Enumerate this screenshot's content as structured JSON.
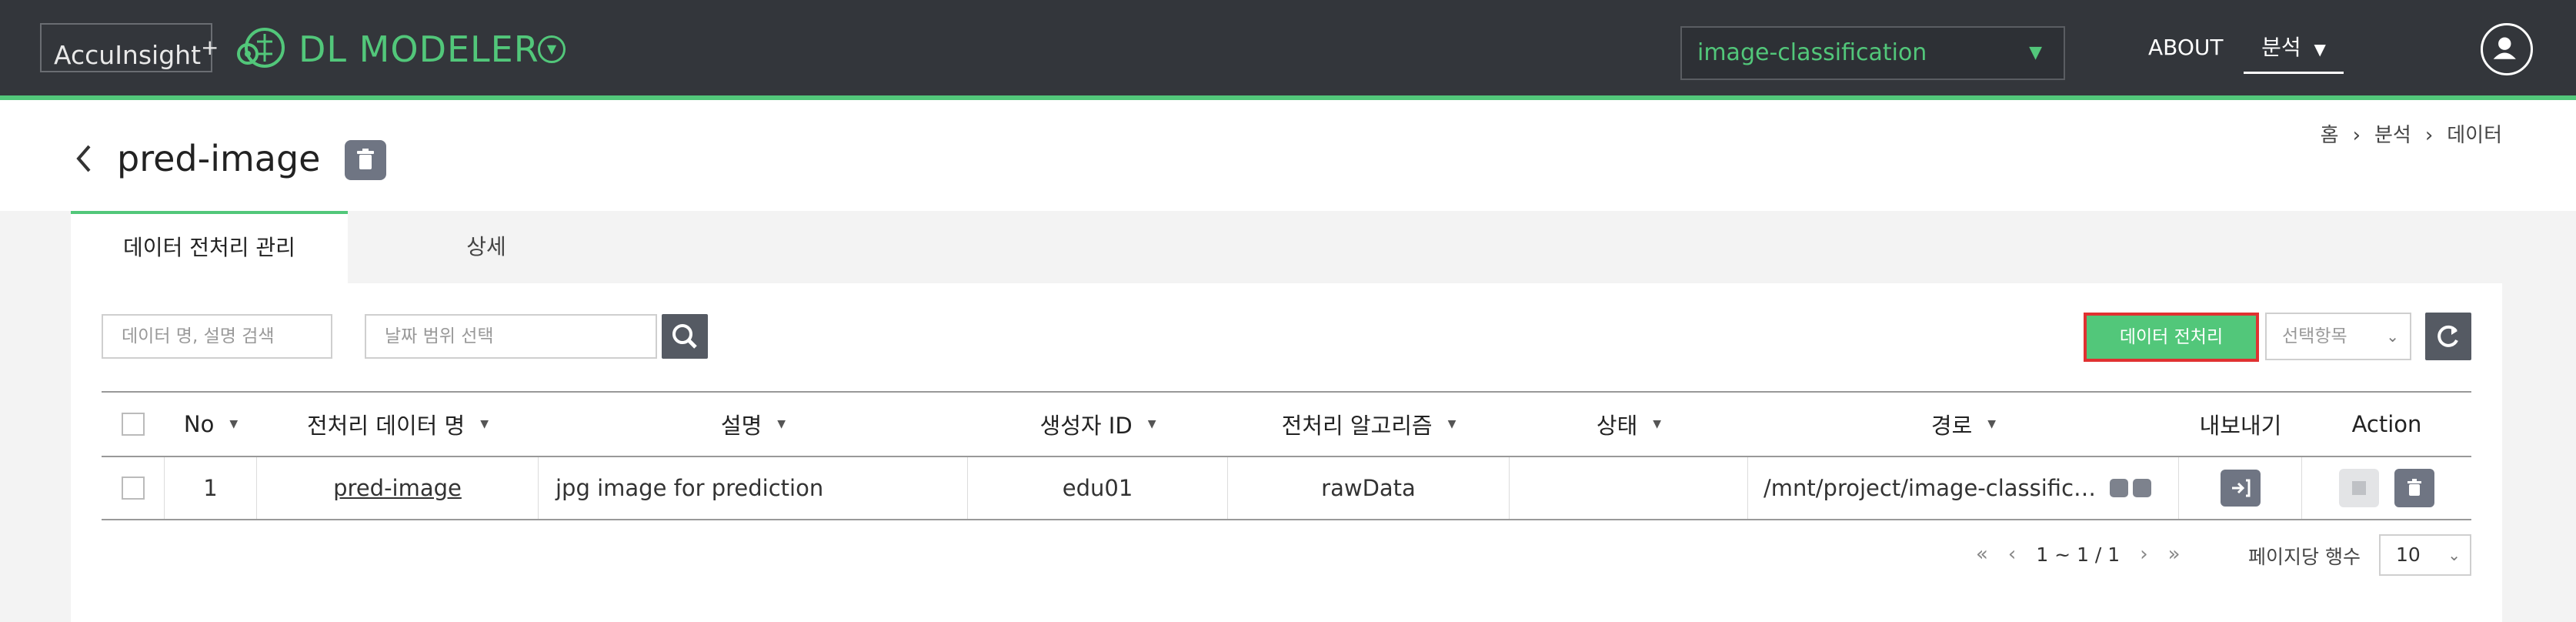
{
  "header": {
    "brand": "AccuInsight",
    "brand_plus": "+",
    "app_title": "DL MODELER",
    "project": "image-classification",
    "nav_about": "ABOUT",
    "nav_analysis": "분석"
  },
  "page": {
    "title": "pred-image",
    "breadcrumb": [
      "홈",
      "분석",
      "데이터"
    ]
  },
  "tabs": [
    {
      "label": "데이터 전처리 관리",
      "active": true
    },
    {
      "label": "상세",
      "active": false
    }
  ],
  "toolbar": {
    "search_placeholder": "데이터 명, 설명 검색",
    "date_placeholder": "날짜 범위 선택",
    "preprocess_label": "데이터 전처리",
    "select_items_label": "선택항목"
  },
  "table": {
    "columns": [
      "No",
      "전처리 데이터 명",
      "설명",
      "생성자 ID",
      "전처리 알고리즘",
      "상태",
      "경로",
      "내보내기",
      "Action"
    ],
    "rows": [
      {
        "no": "1",
        "name": "pred-image",
        "description": "jpg image for prediction",
        "creator": "edu01",
        "algorithm": "rawData",
        "status": "",
        "path": "/mnt/project/image-classification"
      }
    ]
  },
  "pagination": {
    "range": "1 ~ 1 / 1",
    "rows_label": "페이지당 행수",
    "rows_per_page": "10"
  },
  "colors": {
    "header_bg": "#33363b",
    "accent_green": "#52c77a",
    "highlight_red": "#e03131",
    "button_gray": "#6f7583"
  }
}
